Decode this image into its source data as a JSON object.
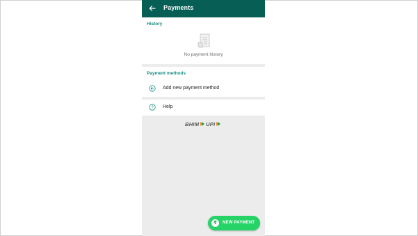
{
  "appbar": {
    "title": "Payments",
    "back_icon": "arrow-left-icon",
    "background": "#075e54"
  },
  "history": {
    "header": "History",
    "empty_icon": "receipt-document-icon",
    "empty_text": "No payment history"
  },
  "payment_methods": {
    "header": "Payment methods",
    "add_label": "Add new payment method",
    "add_icon": "circle-arrow-icon"
  },
  "help": {
    "label": "Help",
    "icon": "help-circle-icon"
  },
  "logo": {
    "text_bhim": "BHIM",
    "text_upi": "UPI"
  },
  "fab": {
    "symbol": "₹",
    "label": "NEW PAYMENT",
    "color": "#25d366"
  },
  "colors": {
    "accent": "#128c7e",
    "background": "#ececec"
  }
}
